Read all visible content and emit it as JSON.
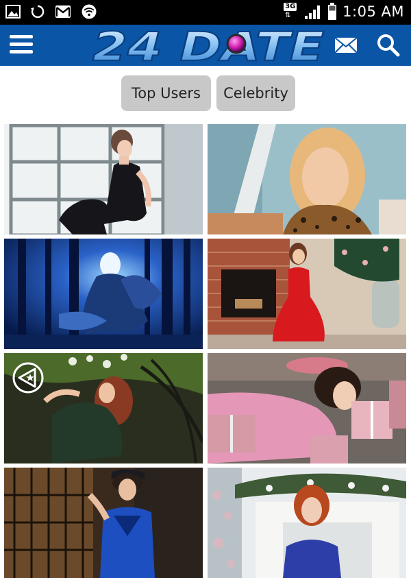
{
  "status_bar": {
    "time": "1:05 AM",
    "network": "3G",
    "icons": [
      "image-icon",
      "sync-icon",
      "gmail-icon",
      "wifi-icon",
      "signal-icon",
      "battery-icon"
    ]
  },
  "header": {
    "logo_text": "24 DATE",
    "icons": [
      "menu-icon",
      "mail-icon",
      "search-icon"
    ],
    "brand_color": "#0a55a6"
  },
  "filters": [
    {
      "label": "Top Users"
    },
    {
      "label": "Celebrity"
    }
  ],
  "photos": [
    {
      "name": "profile-photo-1",
      "scene": "woman-black-sequin-outfit-window-studio"
    },
    {
      "name": "profile-photo-2",
      "scene": "woman-leopard-print-blue-room"
    },
    {
      "name": "profile-photo-3",
      "scene": "fantasy-warrior-woman-blue-forest"
    },
    {
      "name": "profile-photo-4",
      "scene": "woman-red-dress-brick-fireplace"
    },
    {
      "name": "profile-photo-5",
      "scene": "woman-green-dress-garden-bench"
    },
    {
      "name": "profile-photo-6",
      "scene": "woman-pink-sequins-gift-boxes"
    },
    {
      "name": "profile-photo-7",
      "scene": "woman-police-costume-cage"
    },
    {
      "name": "profile-photo-8",
      "scene": "woman-white-fireplace-christmas"
    }
  ],
  "floating_icon": "share-icon"
}
